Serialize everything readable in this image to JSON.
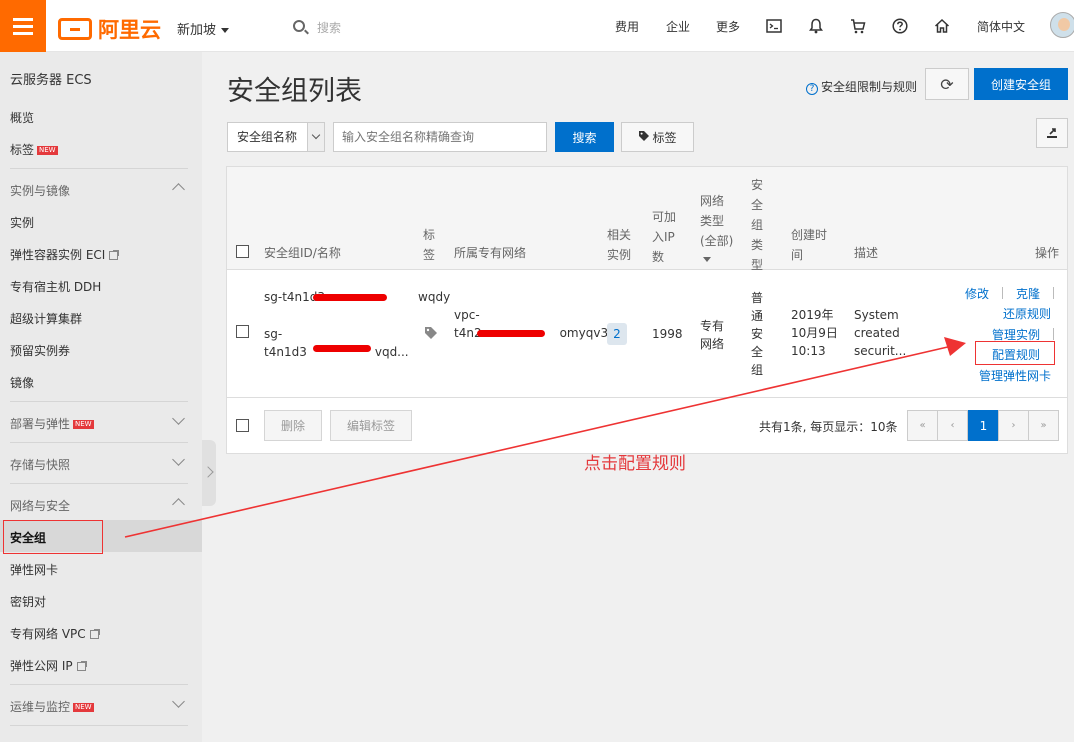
{
  "header": {
    "logo_text": "阿里云",
    "region": "新加坡",
    "search_placeholder": "搜索",
    "nav": [
      "费用",
      "企业",
      "更多"
    ],
    "language": "简体中文"
  },
  "sidebar": {
    "title": "云服务器 ECS",
    "items_top": [
      "概览",
      "标签"
    ],
    "new_badge": "NEW",
    "group_instances": "实例与镜像",
    "instances_items": [
      "实例",
      "弹性容器实例 ECI",
      "专有宿主机 DDH",
      "超级计算集群",
      "预留实例券",
      "镜像"
    ],
    "group_deploy": "部署与弹性",
    "group_storage": "存储与快照",
    "group_network": "网络与安全",
    "network_items": [
      "安全组",
      "弹性网卡",
      "密钥对",
      "专有网络 VPC",
      "弹性公网 IP"
    ],
    "group_ops": "运维与监控"
  },
  "main": {
    "title": "安全组列表",
    "help_link": "安全组限制与规则",
    "create_button": "创建安全组",
    "filter_select": "安全组名称",
    "filter_placeholder": "输入安全组名称精确查询",
    "search_button": "搜索",
    "tag_button": "标签"
  },
  "table": {
    "headers": {
      "id_name": "安全组ID/名称",
      "tag": [
        "标",
        "签"
      ],
      "vpc": "所属专有网络",
      "instances": [
        "相关",
        "实例"
      ],
      "ip": [
        "可加",
        "入IP",
        "数"
      ],
      "net_type": [
        "网络",
        "类型",
        "(全部)"
      ],
      "sg_type": [
        "安",
        "全",
        "组",
        "类",
        "型"
      ],
      "created": [
        "创建时",
        "间"
      ],
      "desc": "描述",
      "ops": "操作"
    },
    "row": {
      "id_line1": "sg-t4n1d3",
      "id_line1_tail": "wqdy",
      "name_line1": "sg-",
      "name_line2": "t4n1d3",
      "name_tail": "vqd...",
      "vpc_line1": "vpc-",
      "vpc_line2": "t4n2",
      "vpc_tail": "omyqv3",
      "instances": "2",
      "ip_count": "1998",
      "net_type": [
        "专有",
        "网络"
      ],
      "sg_type": [
        "普",
        "通",
        "安",
        "全",
        "组"
      ],
      "created": [
        "2019年",
        "10月9日",
        "10:13"
      ],
      "desc": [
        "System",
        "created",
        "securit..."
      ],
      "ops": {
        "modify": "修改",
        "clone": "克隆",
        "restore": "还原规则",
        "manage_instances": "管理实例",
        "config_rules": "配置规则",
        "manage_eni": "管理弹性网卡"
      }
    },
    "footer": {
      "delete": "删除",
      "edit_tags": "编辑标签",
      "summary": "共有1条, 每页显示：10条",
      "pages": [
        "«",
        "‹",
        "1",
        "›",
        "»"
      ]
    }
  },
  "annotation": {
    "text": "点击配置规则",
    "color": "#e4393c"
  }
}
